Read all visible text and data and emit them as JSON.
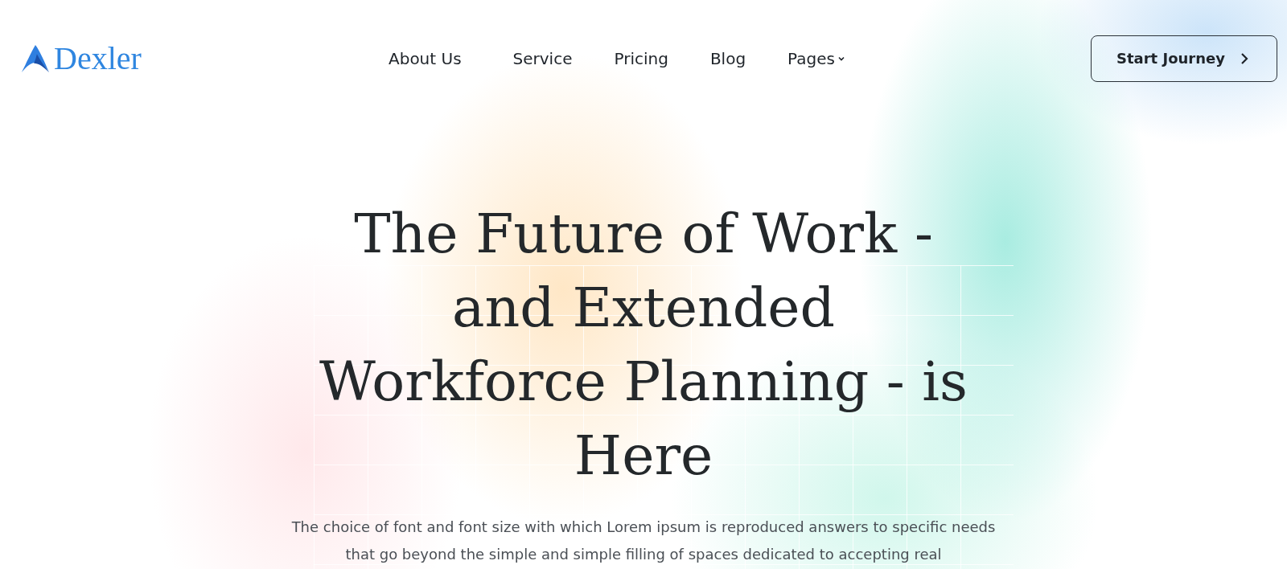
{
  "brand": {
    "name": "Dexler"
  },
  "nav": [
    {
      "label": "About Us",
      "dropdown": false
    },
    {
      "label": "Service",
      "dropdown": false
    },
    {
      "label": "Pricing",
      "dropdown": false
    },
    {
      "label": "Blog",
      "dropdown": false
    },
    {
      "label": "Pages",
      "dropdown": true
    }
  ],
  "cta": {
    "label": "Start Journey"
  },
  "hero": {
    "title": "The Future of Work - and Extended Workforce Planning - is Here",
    "text": "The choice of font and font size with which Lorem ipsum is reproduced answers to specific needs that go beyond the simple and simple filling of spaces dedicated to accepting real"
  }
}
